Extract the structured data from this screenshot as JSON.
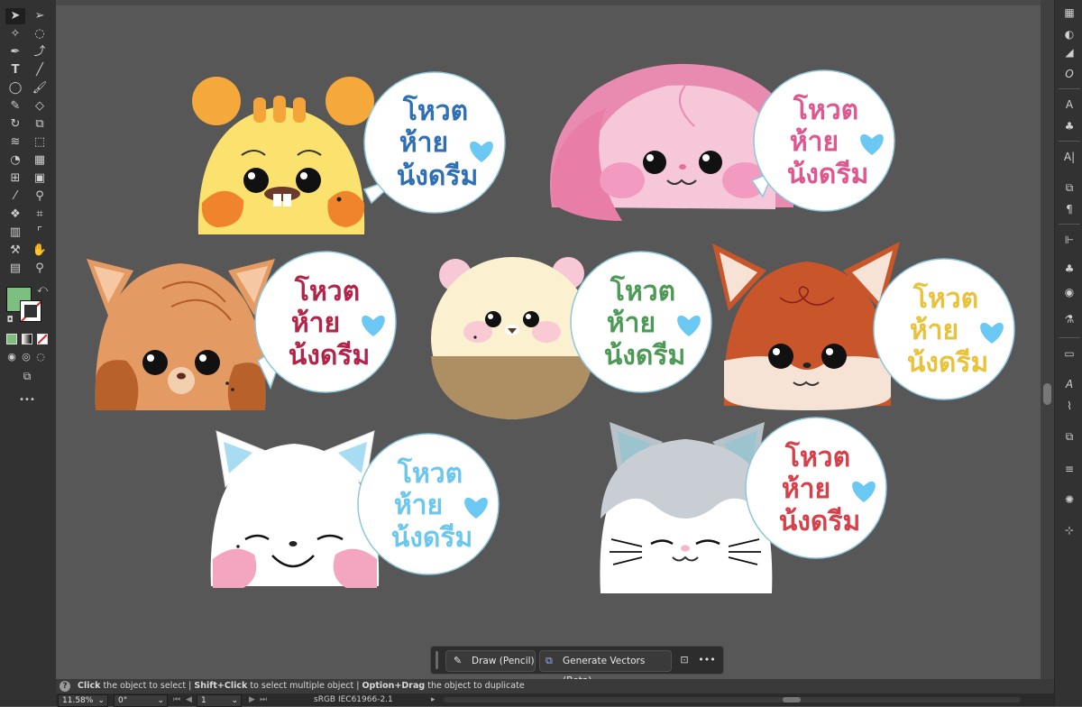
{
  "toolbar": {
    "tools": [
      "selection-tool",
      "direct-selection-tool",
      "magic-wand-tool",
      "lasso-tool",
      "pen-tool",
      "curvature-tool",
      "type-tool",
      "line-tool",
      "ellipse-tool",
      "paintbrush-tool",
      "pencil-tool",
      "eraser-tool",
      "rotate-tool",
      "scale-tool",
      "width-tool",
      "free-transform-tool",
      "shape-builder-tool",
      "perspective-grid-tool",
      "mesh-tool",
      "gradient-tool",
      "eyedropper-tool",
      "blend-tool",
      "symbol-sprayer-tool",
      "slice-tool",
      "column-graph-tool",
      "artboard-tool",
      "perspective-tool",
      "hand-tool",
      "zoom-tool",
      "zoom-search-tool"
    ],
    "fill_color": "#7cbf7f",
    "more_label": "•••"
  },
  "stickers": {
    "text_line1": "โหวต",
    "text_line2": "ห้าย",
    "text_line3": "น้งดรีม",
    "colors": {
      "blue": "#2f6fb3",
      "pink": "#e0568f",
      "maroon": "#b2254a",
      "green": "#4c9a55",
      "yellow": "#e9c23c",
      "skyblue": "#6cc7ec",
      "red": "#d6404a",
      "heart": "#6bc8f2"
    }
  },
  "context_bar": {
    "draw_label": "Draw (Pencil)",
    "generate_label": "Generate Vectors (Beta)",
    "more_label": "•••"
  },
  "hint": {
    "click_bold": "Click",
    "click_text": " the object to select  |  ",
    "shift_bold": "Shift+Click",
    "shift_text": " to select multiple object  |  ",
    "option_bold": "Option+Drag",
    "option_text": " the object to duplicate"
  },
  "status": {
    "zoom": "11.58%",
    "rotation": "0°",
    "artboard": "1",
    "color_profile": "sRGB IEC61966-2.1"
  }
}
